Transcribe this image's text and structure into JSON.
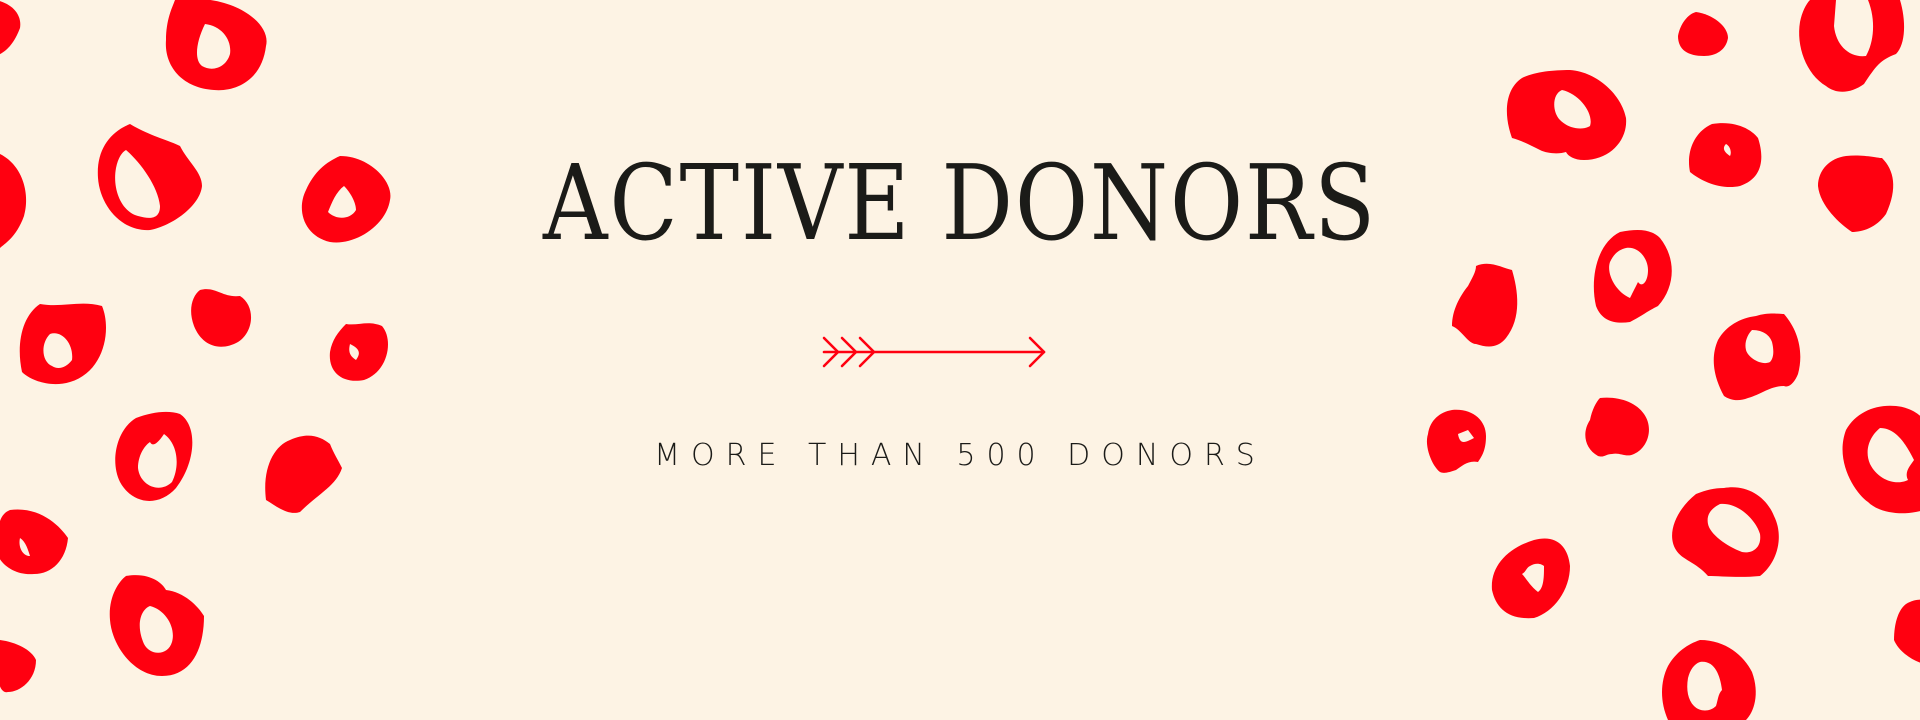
{
  "banner": {
    "title": "ACTIVE DONORS",
    "subtitle": "MORE THAN 500 DONORS"
  },
  "colors": {
    "background": "#fdf3e4",
    "accent": "#ff0010",
    "text": "#1b1b18"
  },
  "icons": {
    "divider": "arrow-right-icon",
    "decor": "blood-drop-blob"
  }
}
